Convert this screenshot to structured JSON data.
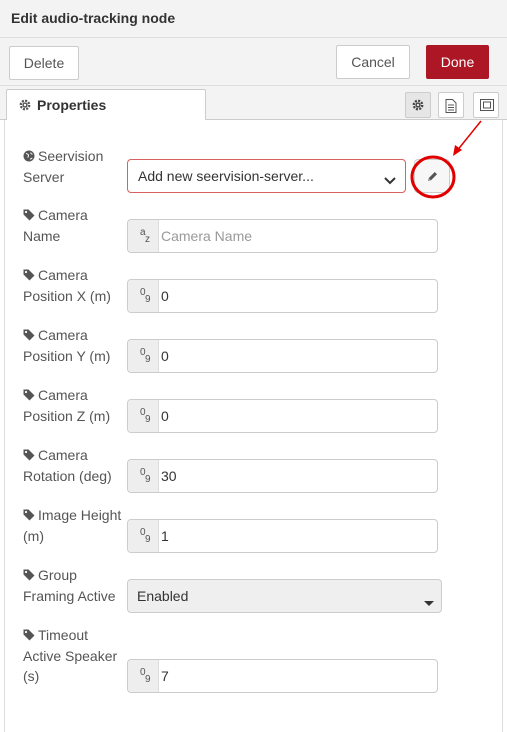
{
  "header": {
    "title": "Edit audio-tracking node"
  },
  "toolbar": {
    "delete_label": "Delete",
    "cancel_label": "Cancel",
    "done_label": "Done"
  },
  "tabs": {
    "properties_label": "Properties",
    "icons": [
      "gear-icon",
      "description-icon",
      "appearance-icon"
    ]
  },
  "form": {
    "server": {
      "label_1": "Seervision",
      "label_2": "Server",
      "value": "Add new seervision-server..."
    },
    "camera_name": {
      "label_1": "Camera",
      "label_2": "Name",
      "placeholder": "Camera Name",
      "type_sup": "a",
      "type_sub": "z"
    },
    "pos_x": {
      "label_1": "Camera",
      "label_2": "Position X (m)",
      "value": "0"
    },
    "pos_y": {
      "label_1": "Camera",
      "label_2": "Position Y (m)",
      "value": "0"
    },
    "pos_z": {
      "label_1": "Camera",
      "label_2": "Position Z (m)",
      "value": "0"
    },
    "rotation": {
      "label_1": "Camera",
      "label_2": "Rotation (deg)",
      "value": "30"
    },
    "image_height": {
      "label_1": "Image Height",
      "label_2": "(m)",
      "value": "1"
    },
    "group_framing": {
      "label_1": "Group",
      "label_2": "Framing Active",
      "value": "Enabled"
    },
    "timeout": {
      "label_1": "Timeout",
      "label_2": "Active Speaker",
      "label_3": "(s)",
      "value": "7"
    },
    "num_type_sup": "0",
    "num_type_sub": "9"
  },
  "colors": {
    "done_bg": "#ad1625",
    "annotation": "#e00000",
    "invalid_border": "#d6615e"
  }
}
